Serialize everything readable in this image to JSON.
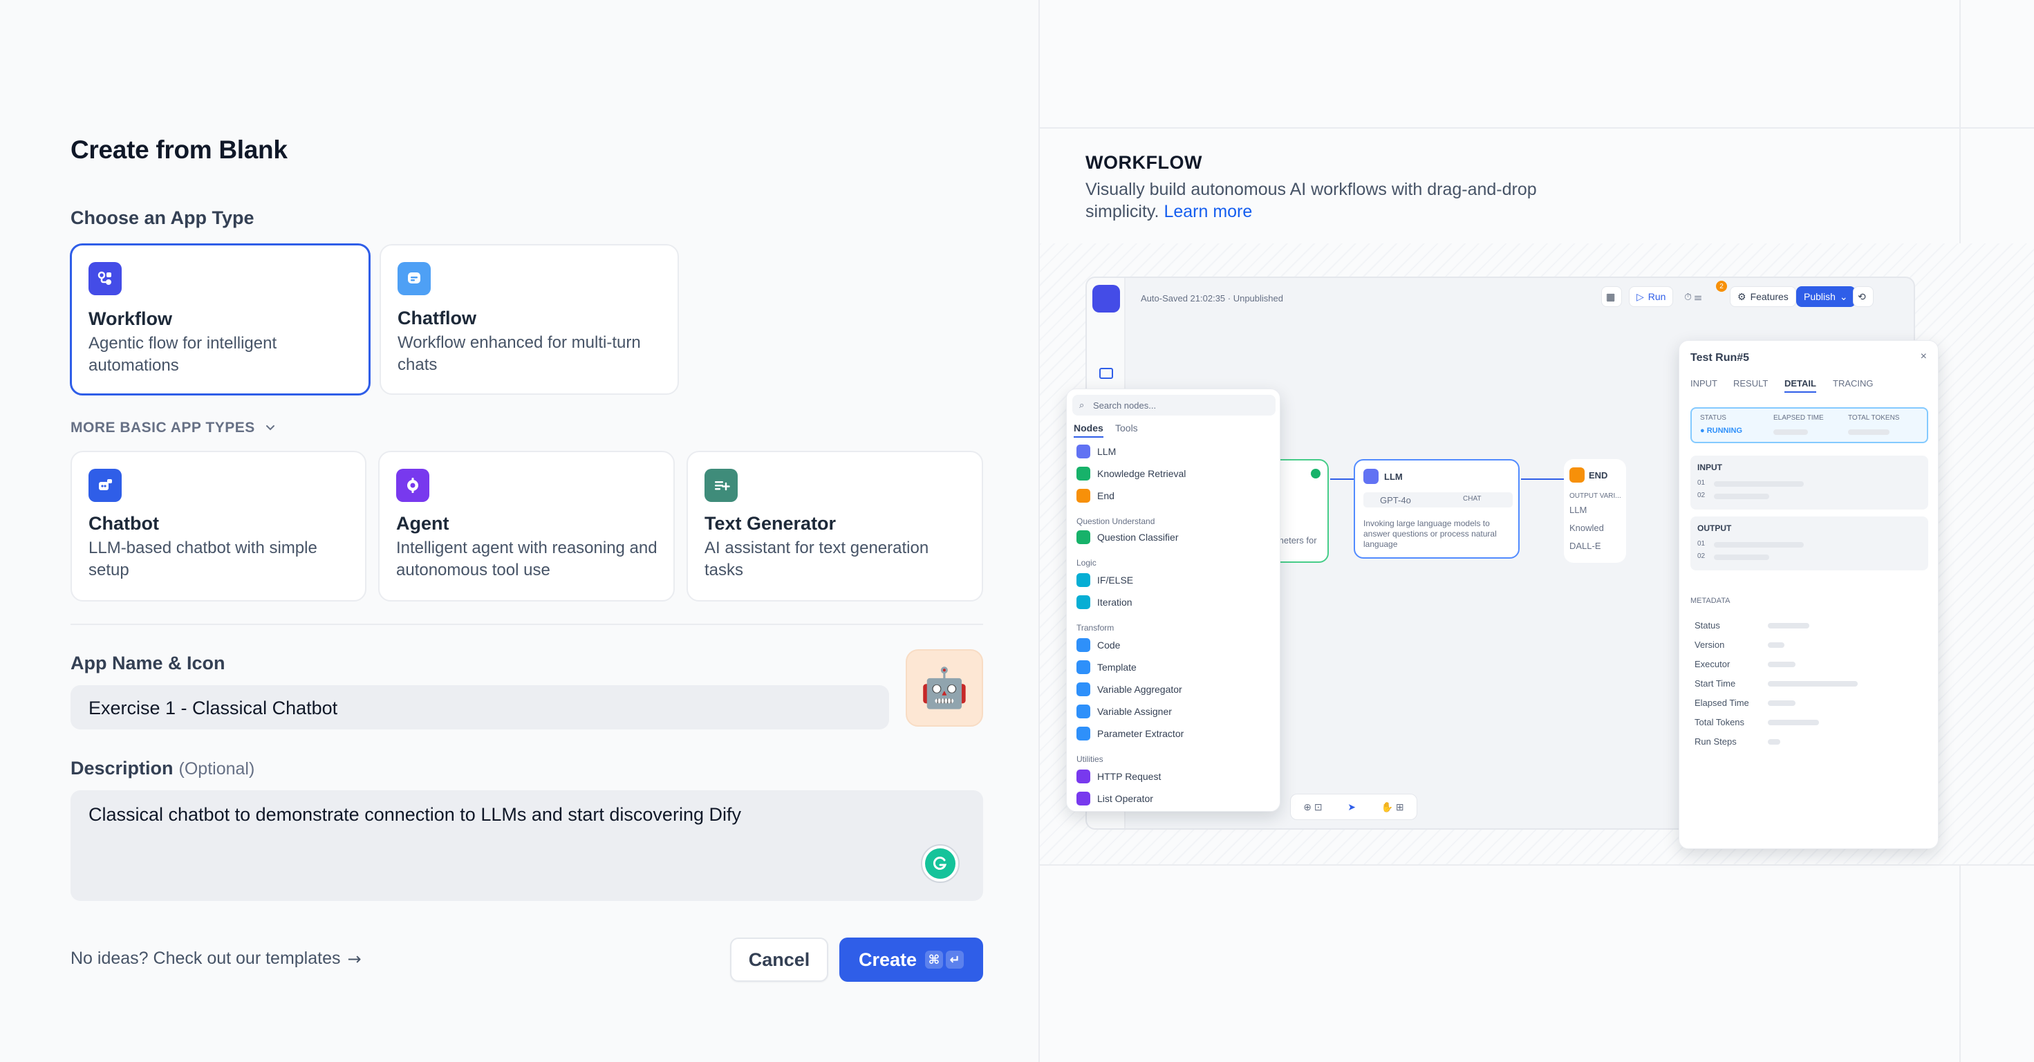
{
  "dialog": {
    "title": "Create from Blank",
    "choose_label": "Choose an App Type",
    "primary_types": [
      {
        "title": "Workflow",
        "desc": "Agentic flow for intelligent automations"
      },
      {
        "title": "Chatflow",
        "desc": "Workflow enhanced for multi-turn chats"
      }
    ],
    "more_types_label": "MORE BASIC APP TYPES",
    "basic_types": [
      {
        "title": "Chatbot",
        "desc": "LLM-based chatbot with simple setup"
      },
      {
        "title": "Agent",
        "desc": "Intelligent agent with reasoning and autonomous tool use"
      },
      {
        "title": "Text Generator",
        "desc": "AI assistant for text generation tasks"
      }
    ],
    "name_label": "App Name & Icon",
    "name_value": "Exercise 1 - Classical Chatbot",
    "app_icon": "🤖",
    "desc_label": "Description",
    "desc_optional": "(Optional)",
    "desc_value": "Classical chatbot to demonstrate connection to LLMs and start discovering Dify",
    "templates_link": "No ideas? Check out our templates",
    "templates_arrow": "→",
    "cancel_label": "Cancel",
    "create_label": "Create",
    "kbd_cmd": "⌘",
    "kbd_enter": "↵"
  },
  "preview": {
    "type_title": "WORKFLOW",
    "desc": "Visually build autonomous AI workflows with drag-and-drop simplicity.",
    "learn_more": "Learn more",
    "mock": {
      "autosave": "Auto-Saved 21:02:35 · Unpublished",
      "run": "Run",
      "badge_count": "2",
      "features": "Features",
      "publish": "Publish",
      "search_placeholder": "Search nodes...",
      "tab_nodes": "Nodes",
      "tab_tools": "Tools",
      "node_items": [
        "LLM",
        "Knowledge Retrieval",
        "End"
      ],
      "group_qu": "Question Understand",
      "qu_items": [
        "Question Classifier"
      ],
      "group_logic": "Logic",
      "logic_items": [
        "IF/ELSE",
        "Iteration"
      ],
      "group_transform": "Transform",
      "transform_items": [
        "Code",
        "Template",
        "Variable Aggregator",
        "Variable Assigner",
        "Parameter Extractor"
      ],
      "group_utilities": "Utilities",
      "utility_items": [
        "HTTP Request",
        "List Operator"
      ],
      "llm_title": "LLM",
      "llm_model": "GPT-4o",
      "llm_chat": "CHAT",
      "llm_desc": "Invoking large language models to answer questions or process natural language",
      "start_partial": "parameters for flow",
      "end_title": "END",
      "end_output": "OUTPUT VARI...",
      "end_llm": "LLM",
      "end_knowledge": "Knowled",
      "end_dalle": "DALL-E",
      "testrun_title": "Test Run#5",
      "testrun_close": "×",
      "tabs": [
        "INPUT",
        "RESULT",
        "DETAIL",
        "TRACING"
      ],
      "status_label": "STATUS",
      "status_value": "RUNNING",
      "elapsed_label": "ELAPSED TIME",
      "tokens_label": "TOTAL TOKENS",
      "input_label": "INPUT",
      "output_label": "OUTPUT",
      "line1": "01",
      "line2": "02",
      "metadata_label": "METADATA",
      "meta_rows": [
        "Status",
        "Version",
        "Executor",
        "Start Time",
        "Elapsed Time",
        "Total Tokens",
        "Run Steps"
      ]
    }
  },
  "colors": {
    "accent": "#2f5ee8",
    "workflow_icon": "#444ce7",
    "chatflow_icon": "#4ea0f5",
    "chatbot_icon": "#2f5ee8",
    "agent_icon": "#7839ee",
    "textgen_icon": "#3f8c7a"
  }
}
